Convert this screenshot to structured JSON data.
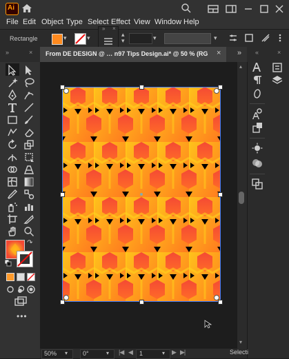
{
  "app": {
    "logo_text": "Ai",
    "logo_color": "#ff9a00"
  },
  "menu": [
    "File",
    "Edit",
    "Object",
    "Type",
    "Select",
    "Effect",
    "View",
    "Window",
    "Help"
  ],
  "control": {
    "object_label": "Rectangle",
    "fill_color": "#ff8a1f",
    "stroke_label": "none"
  },
  "document_tab": {
    "title": "From DE DESIGN @ … n97  Tips Design.ai* @ 50 % (RG…",
    "close": "×"
  },
  "status": {
    "zoom": "50%",
    "rotation": "0°",
    "artboard": "1",
    "tool_name": "Selecti"
  },
  "artwork": {
    "colors": [
      "#f44a34",
      "#ff7a1e",
      "#ffb21a",
      "#ffd21b",
      "#000000"
    ]
  },
  "colors": {
    "panel": "#323232",
    "canvas": "#1d1d1d",
    "accent": "#ff9a00"
  }
}
